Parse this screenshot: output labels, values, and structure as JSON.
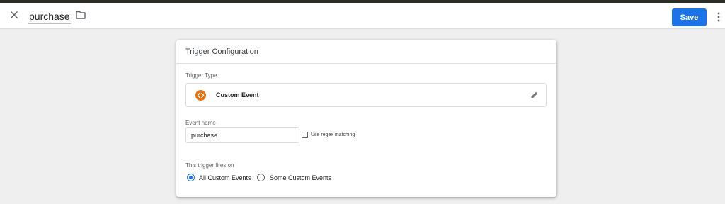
{
  "app_bar": {
    "close_icon": "close-icon",
    "name_value": "purchase",
    "folder_icon": "folder-icon",
    "save_label": "Save",
    "more_icon": "more-vert-icon",
    "accent_color": "#1a73e8"
  },
  "card": {
    "title": "Trigger Configuration",
    "trigger_type_label": "Trigger Type",
    "trigger_type": {
      "icon": "custom-event-icon",
      "icon_color": "#e8710a",
      "name": "Custom Event",
      "edit_icon": "pencil-icon"
    },
    "event_name_label": "Event name",
    "event_name_value": "purchase",
    "regex_label": "Use regex matching",
    "regex_checked": false,
    "fires_on_label": "This trigger fires on",
    "fires_on_options": [
      {
        "label": "All Custom Events",
        "selected": true
      },
      {
        "label": "Some Custom Events",
        "selected": false
      }
    ]
  }
}
